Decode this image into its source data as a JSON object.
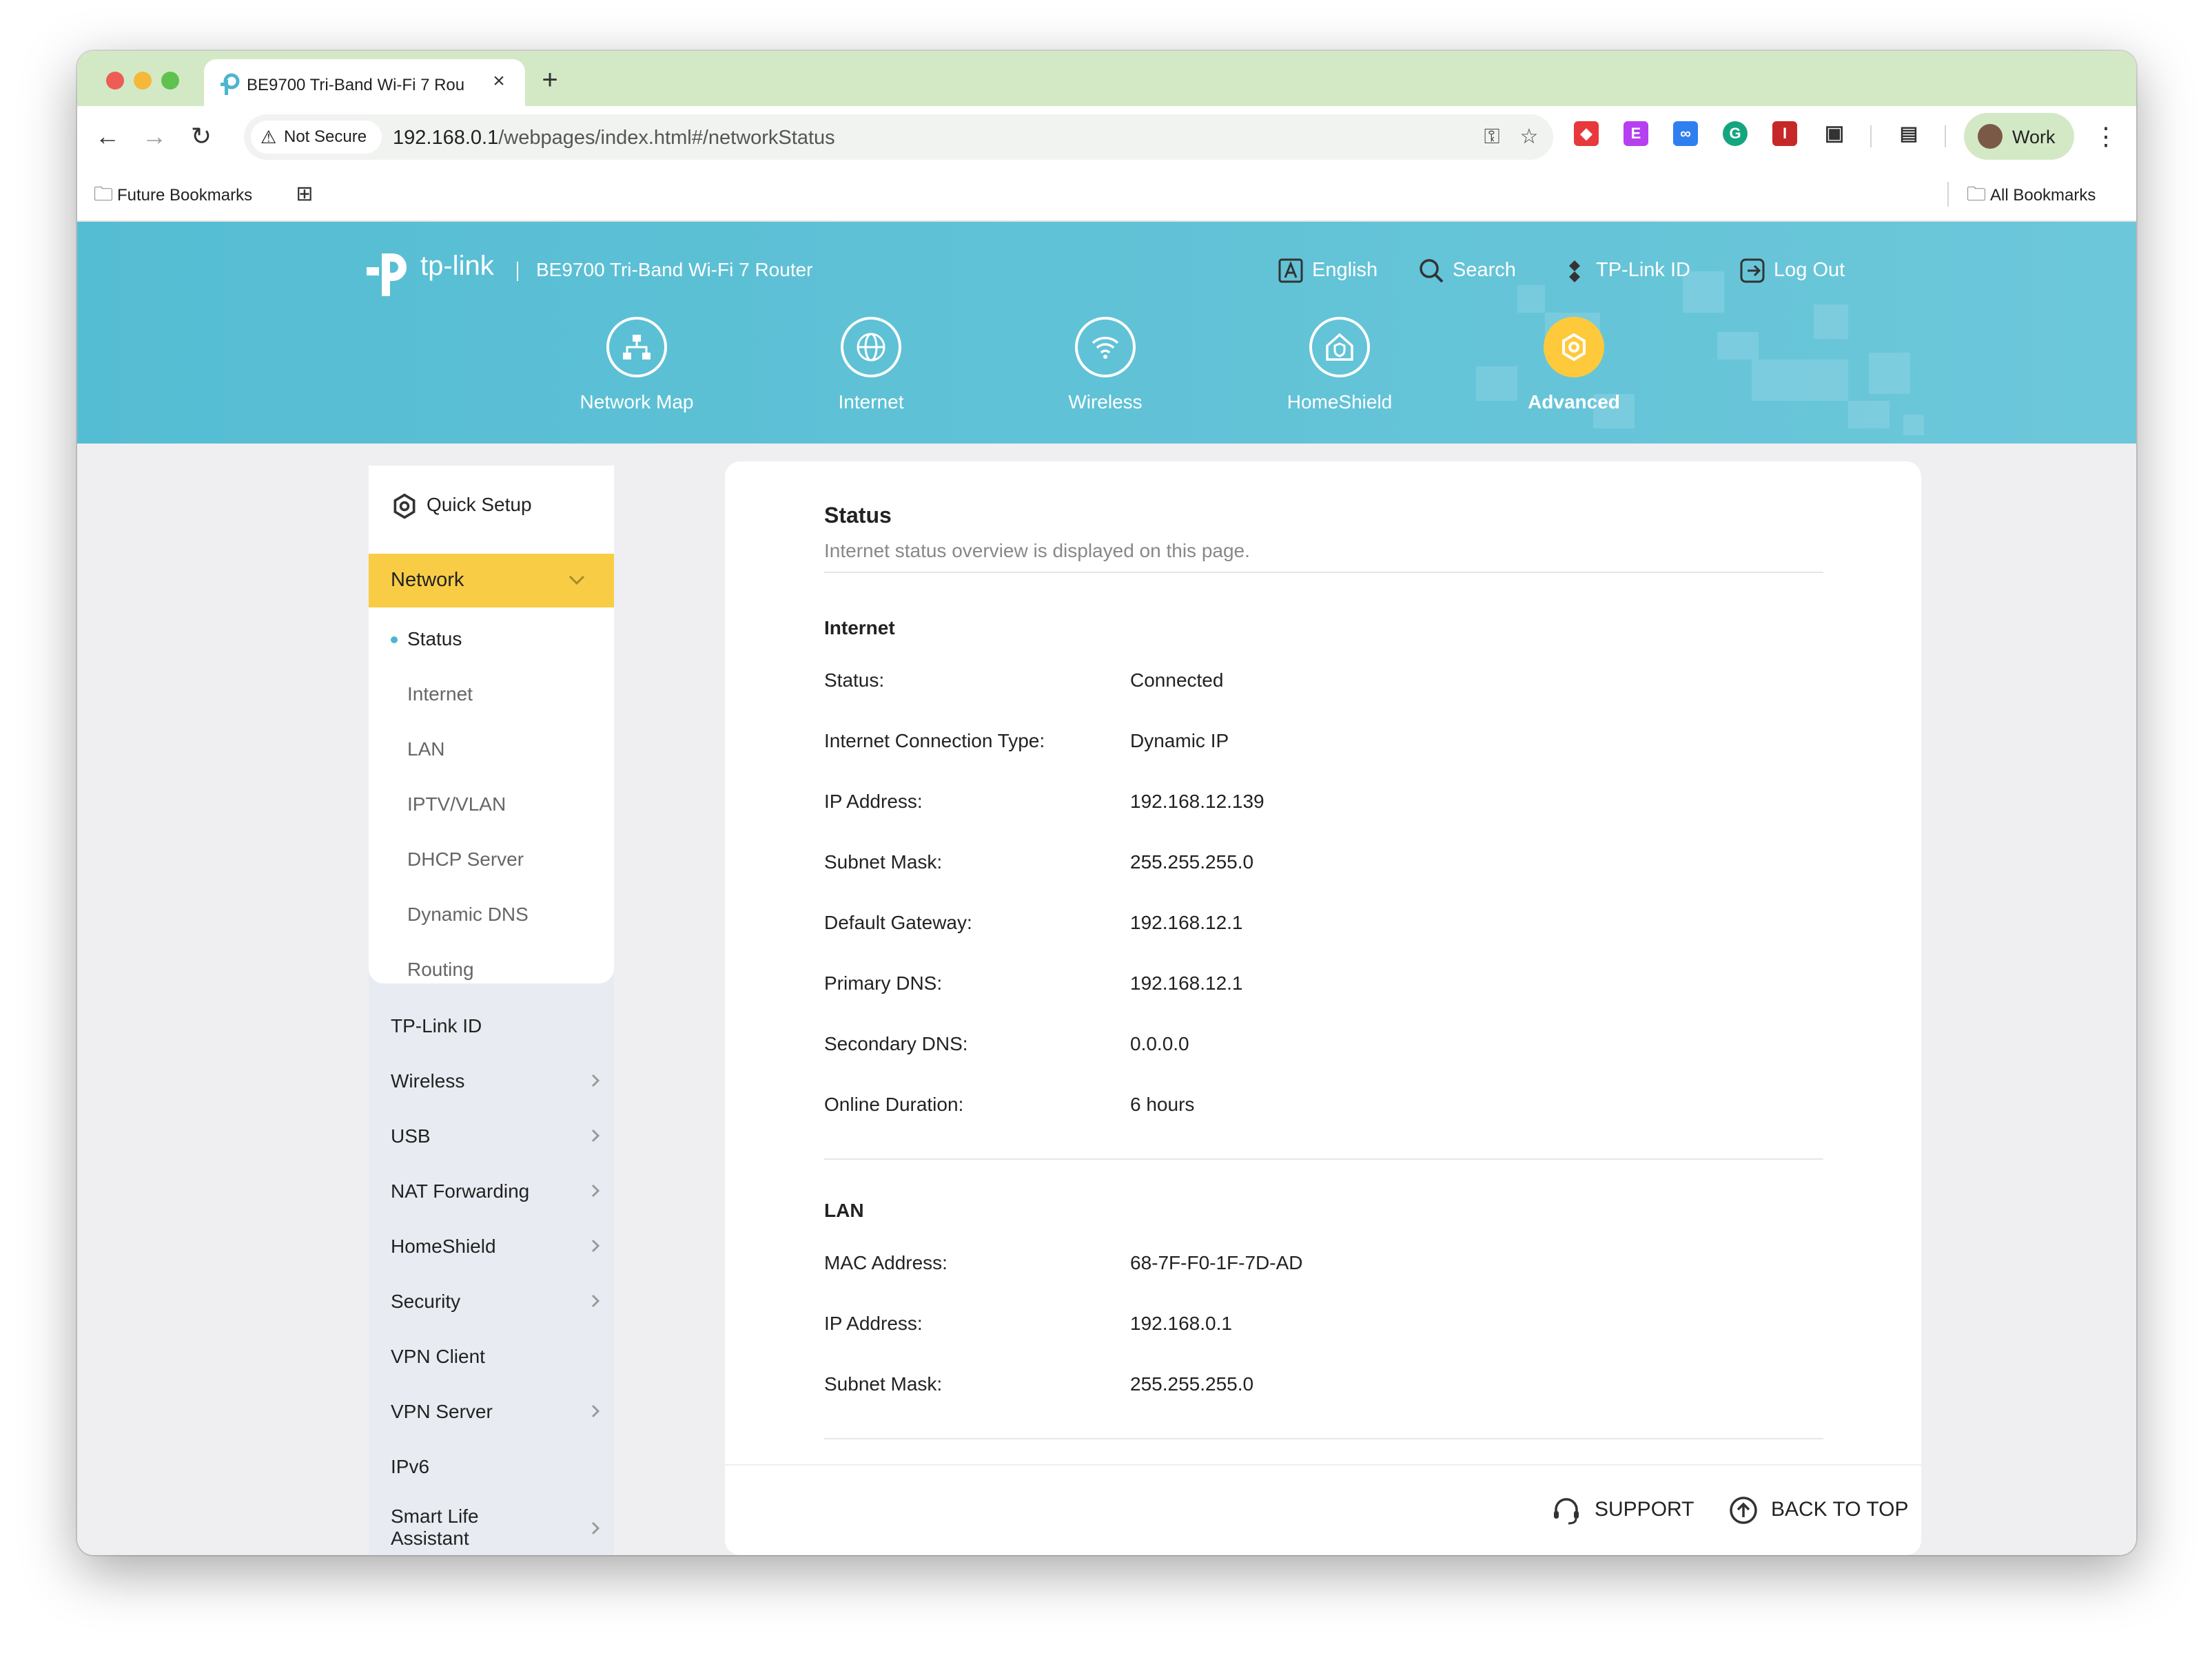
{
  "browser": {
    "tab_title": "BE9700 Tri-Band Wi-Fi 7 Rou",
    "tab_close": "×",
    "new_tab": "+",
    "security_label": "Not Secure",
    "url_host": "192.168.0.1",
    "url_path": "/webpages/index.html#/networkStatus",
    "profile_label": "Work",
    "bookmarks": {
      "left_label": "Future Bookmarks",
      "right_label": "All Bookmarks"
    },
    "extensions": [
      {
        "icon": "bookmark-tag-icon",
        "color": "#e8383b"
      },
      {
        "icon": "letter-e-extension-icon",
        "color": "#b63ff0",
        "text": "E"
      },
      {
        "icon": "link-extension-icon",
        "color": "#2f7ff0"
      },
      {
        "icon": "grammarly-icon",
        "color": "#15c39a"
      },
      {
        "icon": "instapaper-icon",
        "color": "#c62828",
        "text": "I"
      }
    ]
  },
  "router": {
    "brand": "tp-link",
    "model": "BE9700 Tri-Band Wi-Fi 7 Router",
    "header_links": {
      "language": "English",
      "search": "Search",
      "tplink_id": "TP-Link ID",
      "logout": "Log Out"
    },
    "nav": [
      {
        "label": "Network Map",
        "icon": "network-map-icon",
        "active": false
      },
      {
        "label": "Internet",
        "icon": "globe-icon",
        "active": false
      },
      {
        "label": "Wireless",
        "icon": "wifi-icon",
        "active": false
      },
      {
        "label": "HomeShield",
        "icon": "homeshield-icon",
        "active": false
      },
      {
        "label": "Advanced",
        "icon": "gear-icon",
        "active": true
      }
    ],
    "colors": {
      "header": "#5dc1d6",
      "accent": "#f9cc46",
      "active_dot": "#4db5cf"
    }
  },
  "sidebar": {
    "quick_setup": "Quick Setup",
    "network": "Network",
    "network_items": [
      "Status",
      "Internet",
      "LAN",
      "IPTV/VLAN",
      "DHCP Server",
      "Dynamic DNS",
      "Routing"
    ],
    "active_subitem": "Status",
    "items": [
      {
        "label": "TP-Link ID",
        "chevron": false
      },
      {
        "label": "Wireless",
        "chevron": true
      },
      {
        "label": "USB",
        "chevron": true
      },
      {
        "label": "NAT Forwarding",
        "chevron": true
      },
      {
        "label": "HomeShield",
        "chevron": true
      },
      {
        "label": "Security",
        "chevron": true
      },
      {
        "label": "VPN Client",
        "chevron": false
      },
      {
        "label": "VPN Server",
        "chevron": true
      },
      {
        "label": "IPv6",
        "chevron": false
      },
      {
        "label": "Smart Life",
        "label2": "Assistant",
        "chevron": true
      }
    ]
  },
  "main": {
    "title": "Status",
    "subtitle": "Internet status overview is displayed on this page.",
    "internet": {
      "heading": "Internet",
      "rows": [
        {
          "label": "Status:",
          "value": "Connected"
        },
        {
          "label": "Internet Connection Type:",
          "value": "Dynamic IP"
        },
        {
          "label": "IP Address:",
          "value": "192.168.12.139"
        },
        {
          "label": "Subnet Mask:",
          "value": "255.255.255.0"
        },
        {
          "label": "Default Gateway:",
          "value": "192.168.12.1"
        },
        {
          "label": "Primary DNS:",
          "value": "192.168.12.1"
        },
        {
          "label": "Secondary DNS:",
          "value": "0.0.0.0"
        },
        {
          "label": "Online Duration:",
          "value": "6 hours"
        }
      ]
    },
    "lan": {
      "heading": "LAN",
      "rows": [
        {
          "label": "MAC Address:",
          "value": "68-7F-F0-1F-7D-AD"
        },
        {
          "label": "IP Address:",
          "value": "192.168.0.1"
        },
        {
          "label": "Subnet Mask:",
          "value": "255.255.255.0"
        }
      ]
    },
    "footer": {
      "support": "SUPPORT",
      "back_to_top": "BACK TO TOP"
    }
  }
}
